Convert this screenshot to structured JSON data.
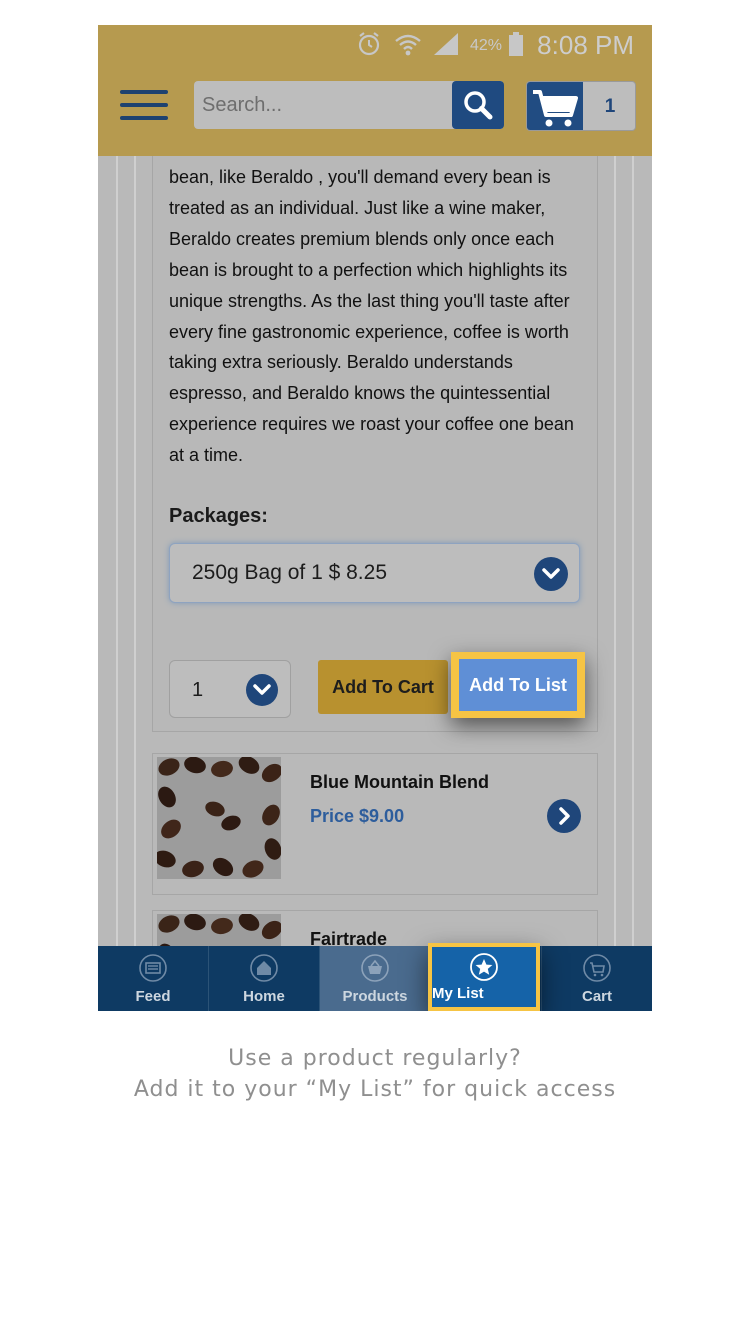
{
  "status_bar": {
    "battery_percent": "42%",
    "time": "8:08 PM",
    "icons": [
      "alarm-icon",
      "wifi-icon",
      "signal-icon",
      "battery-icon"
    ]
  },
  "header": {
    "menu_icon": "hamburger-icon",
    "search": {
      "placeholder": "Search...",
      "icon": "search-icon"
    },
    "cart": {
      "icon": "cart-icon",
      "count": "1"
    }
  },
  "product_detail": {
    "description": "bean, like Beraldo , you'll demand every bean is treated as an individual. Just like a wine maker, Beraldo creates premium blends only once each bean is brought to a perfection which highlights its unique strengths. As the last thing you'll taste after every fine gastronomic experience, coffee is worth taking extra seriously. Beraldo understands espresso, and Beraldo knows the quintessential experience requires we roast your coffee one bean at a time.",
    "packages_label": "Packages:",
    "package_selected": "250g Bag of 1 $ 8.25",
    "quantity": "1",
    "add_to_cart_label": "Add To Cart",
    "add_to_list_label": "Add To List"
  },
  "related_products": [
    {
      "name": "Blue Mountain Blend",
      "price": "Price $9.00"
    },
    {
      "name": "Fairtrade",
      "price": ""
    }
  ],
  "bottom_nav": [
    {
      "label": "Feed",
      "icon": "feed-icon"
    },
    {
      "label": "Home",
      "icon": "home-icon"
    },
    {
      "label": "Products",
      "icon": "basket-icon"
    },
    {
      "label": "My List",
      "icon": "star-icon"
    },
    {
      "label": "Cart",
      "icon": "cart-icon"
    }
  ],
  "caption": {
    "line1": "Use a product regularly?",
    "line2": "Add it to your “My List” for quick access"
  },
  "colors": {
    "header_bg": "#b69a4f",
    "brand_blue": "#1f467a",
    "highlight": "#f6c444",
    "nav_bg": "#0e3a63"
  }
}
